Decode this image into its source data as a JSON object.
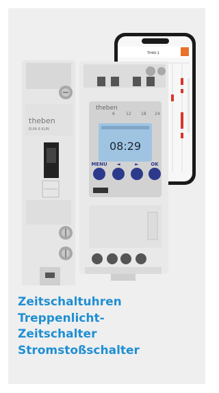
{
  "caption_links": [
    "Zeitschaltuhren",
    "Treppenlicht-",
    "Zeitschalter",
    "Stromstoßschalter"
  ],
  "product_image": {
    "brand_label": "theben",
    "left_device_model": "ELPA 8 KLIN",
    "timer_display_time": "08:29",
    "timer_buttons": [
      "MENU",
      "◄",
      "►",
      "OK"
    ],
    "timer_dial_numbers": [
      "6",
      "12",
      "18",
      "24"
    ],
    "phone_header": "TH40-1"
  },
  "colors": {
    "link_blue": "#1f8fd3",
    "card_background": "#efefef",
    "lcd_blue": "#9fc4e2",
    "button_blue": "#2d3a8c",
    "phone_accent": "#e8722a"
  }
}
